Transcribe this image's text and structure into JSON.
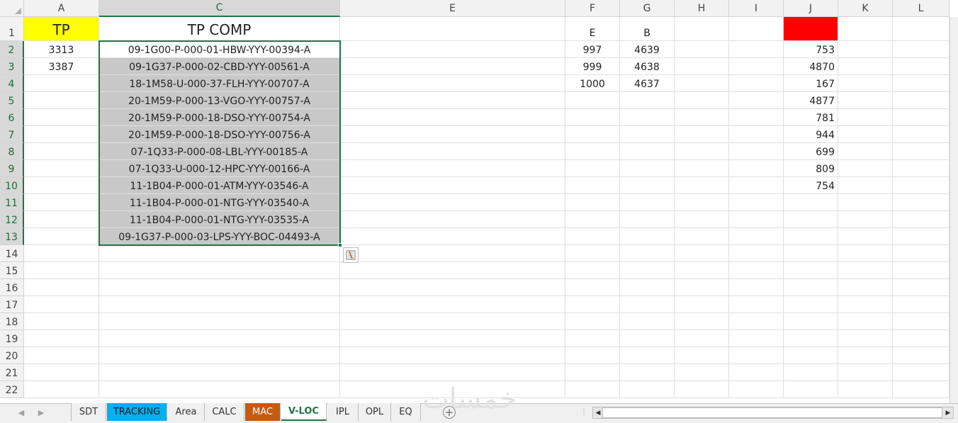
{
  "columns": [
    "A",
    "C",
    "E",
    "F",
    "G",
    "H",
    "I",
    "J",
    "K",
    "L"
  ],
  "row_numbers": [
    "1",
    "2",
    "3",
    "4",
    "5",
    "6",
    "7",
    "8",
    "9",
    "10",
    "11",
    "12",
    "13",
    "14",
    "15",
    "16",
    "17",
    "18",
    "19",
    "20",
    "21",
    "22"
  ],
  "cells": {
    "A1": "TP",
    "C1": "TP COMP",
    "F1": "E",
    "G1": "B",
    "A2": "3313",
    "A3": "3387",
    "C": [
      "09-1G00-P-000-01-HBW-YYY-00394-A",
      "09-1G37-P-000-02-CBD-YYY-00561-A",
      "18-1M58-U-000-37-FLH-YYY-00707-A",
      "20-1M59-P-000-13-VGO-YYY-00757-A",
      "20-1M59-P-000-18-DSO-YYY-00754-A",
      "20-1M59-P-000-18-DSO-YYY-00756-A",
      "07-1Q33-P-000-08-LBL-YYY-00185-A",
      "07-1Q33-U-000-12-HPC-YYY-00166-A",
      "11-1B04-P-000-01-ATM-YYY-03546-A",
      "11-1B04-P-000-01-NTG-YYY-03540-A",
      "11-1B04-P-000-01-NTG-YYY-03535-A",
      "09-1G37-P-000-03-LPS-YYY-BOC-04493-A"
    ],
    "F": [
      "997",
      "999",
      "1000"
    ],
    "G": [
      "4639",
      "4638",
      "4637"
    ],
    "J": [
      "753",
      "4870",
      "167",
      "4877",
      "781",
      "944",
      "699",
      "809",
      "754"
    ]
  },
  "tabs": [
    "SDT",
    "TRACKING",
    "Area",
    "CALC",
    "MAC",
    "V-LOC",
    "IPL",
    "OPL",
    "EQ"
  ],
  "active_tab": "V-LOC",
  "nav_icons": [
    "scroll-left-icon",
    "scroll-right-icon"
  ],
  "watermark": "خمسات",
  "colors": {
    "selection": "#217346",
    "highlight_grey": "#c8c8c8",
    "yellow": "#ffff00",
    "red": "#ff0000",
    "tab_blue": "#00b0f0",
    "tab_orange": "#c55a11"
  }
}
